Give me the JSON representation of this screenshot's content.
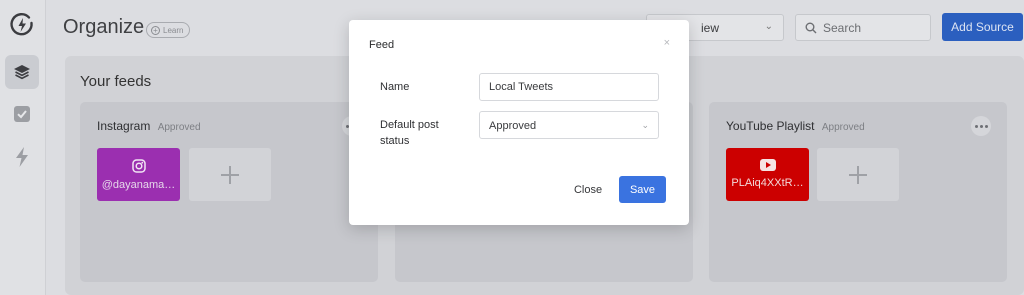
{
  "header": {
    "title": "Organize",
    "learn_label": "Learn",
    "view_select_value": "iew",
    "search_placeholder": "Search",
    "add_source_label": "Add Source"
  },
  "sidebar": {
    "items": [
      {
        "icon": "layers-icon",
        "active": true
      },
      {
        "icon": "check-square-icon",
        "active": false
      },
      {
        "icon": "lightning-icon",
        "active": false
      }
    ]
  },
  "feeds": {
    "title": "Your feeds",
    "cards": [
      {
        "name": "Instagram",
        "status": "Approved",
        "source_label": "@dayanama…",
        "source_icon": "instagram-icon",
        "source_color": "#9b2fb0"
      },
      {
        "name": "YouTube Playlist",
        "status": "Approved",
        "source_label": "PLAiq4XXtR…",
        "source_icon": "youtube-icon",
        "source_color": "#cc0000"
      }
    ]
  },
  "modal": {
    "title": "Feed",
    "close_glyph": "×",
    "name_label": "Name",
    "name_value": "Local Tweets",
    "status_label": "Default post status",
    "status_value": "Approved",
    "cancel_label": "Close",
    "save_label": "Save"
  },
  "colors": {
    "accent": "#3a73e0",
    "instagram": "#9b2fb0",
    "youtube": "#cc0000"
  }
}
